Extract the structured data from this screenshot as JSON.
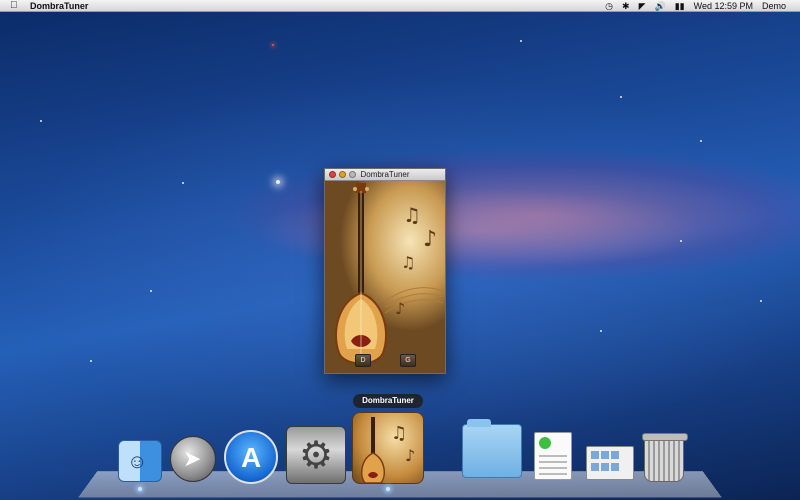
{
  "menubar": {
    "apple_icon": "apple-icon",
    "app_name": "DombraTuner",
    "status_icons": [
      "time-machine-icon",
      "bluetooth-icon",
      "wifi-icon",
      "volume-icon",
      "battery-icon"
    ],
    "clock": "Wed 12:59 PM",
    "user": "Demo"
  },
  "window": {
    "title": "DombraTuner",
    "buttons": [
      "D",
      "G"
    ]
  },
  "dock": {
    "tooltip": "DombraTuner",
    "items": [
      {
        "name": "finder-icon"
      },
      {
        "name": "launchpad-icon"
      },
      {
        "name": "app-store-icon"
      },
      {
        "name": "system-preferences-icon"
      },
      {
        "name": "dombratuner-icon"
      },
      {
        "name": "folder-icon"
      },
      {
        "name": "document-icon"
      },
      {
        "name": "desktop-icon"
      },
      {
        "name": "trash-icon"
      }
    ]
  }
}
